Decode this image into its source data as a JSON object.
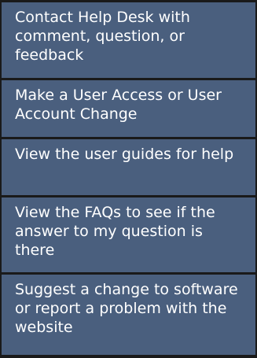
{
  "help_menu": {
    "items": [
      {
        "label": "Contact Help Desk with comment, question, or feedback"
      },
      {
        "label": "Make a User Access or User Account Change"
      },
      {
        "label": "View the user guides for help"
      },
      {
        "label": "View the FAQs to see if the answer to my question is there"
      },
      {
        "label": "Suggest a change to software or report a problem with the website"
      }
    ],
    "colors": {
      "item_background": "#4a5f7e",
      "separator": "#1a1a1a",
      "text": "#ffffff"
    }
  }
}
